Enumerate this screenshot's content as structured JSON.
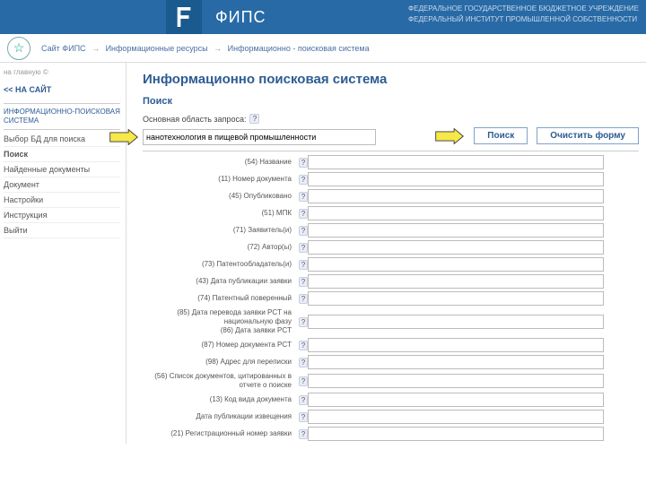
{
  "header": {
    "brand": "ФИПС",
    "agency_line1": "ФЕДЕРАЛЬНОЕ ГОСУДАРСТВЕННОЕ БЮДЖЕТНОЕ УЧРЕЖДЕНИЕ",
    "agency_line2": "ФЕДЕРАЛЬНЫЙ ИНСТИТУТ ПРОМЫШЛЕННОЙ СОБСТВЕННОСТИ"
  },
  "breadcrumb": {
    "item1": "Сайт ФИПС",
    "item2": "Информационные ресурсы",
    "item3": "Информационно - поисковая система"
  },
  "sidebar": {
    "top_note": "на главную ©",
    "back_link": "<< НА САЙТ",
    "block_title": "ИНФОРМАЦИОННО-ПОИСКОВАЯ СИСТЕМА",
    "items": [
      "Выбор БД для поиска",
      "Поиск",
      "Найденные документы",
      "Документ",
      "Настройки",
      "Инструкция",
      "Выйти"
    ]
  },
  "main": {
    "page_title": "Информационно поисковая система",
    "section_title": "Поиск",
    "query_label": "Основная область запроса:",
    "query_value": "нанотехнология в пищевой промышленности",
    "btn_search": "Поиск",
    "btn_clear": "Очистить форму",
    "fields": [
      "(54) Название",
      "(11) Номер документа",
      "(45) Опубликовано",
      "(51) МПК",
      "(71) Заявитель(и)",
      "(72) Автор(ы)",
      "(73) Патентообладатель(и)",
      "(43) Дата публикации заявки",
      "(74) Патентный поверенный",
      "(85) Дата перевода заявки PCT на национальную фазу\n(86) Дата заявки PCT",
      "(87) Номер документа PCT",
      "(98) Адрес для переписки",
      "(56) Список документов, цитированных в отчете о поиске",
      "(13) Код вида документа",
      "Дата публикации извещения",
      "(21) Регистрационный номер заявки"
    ]
  }
}
